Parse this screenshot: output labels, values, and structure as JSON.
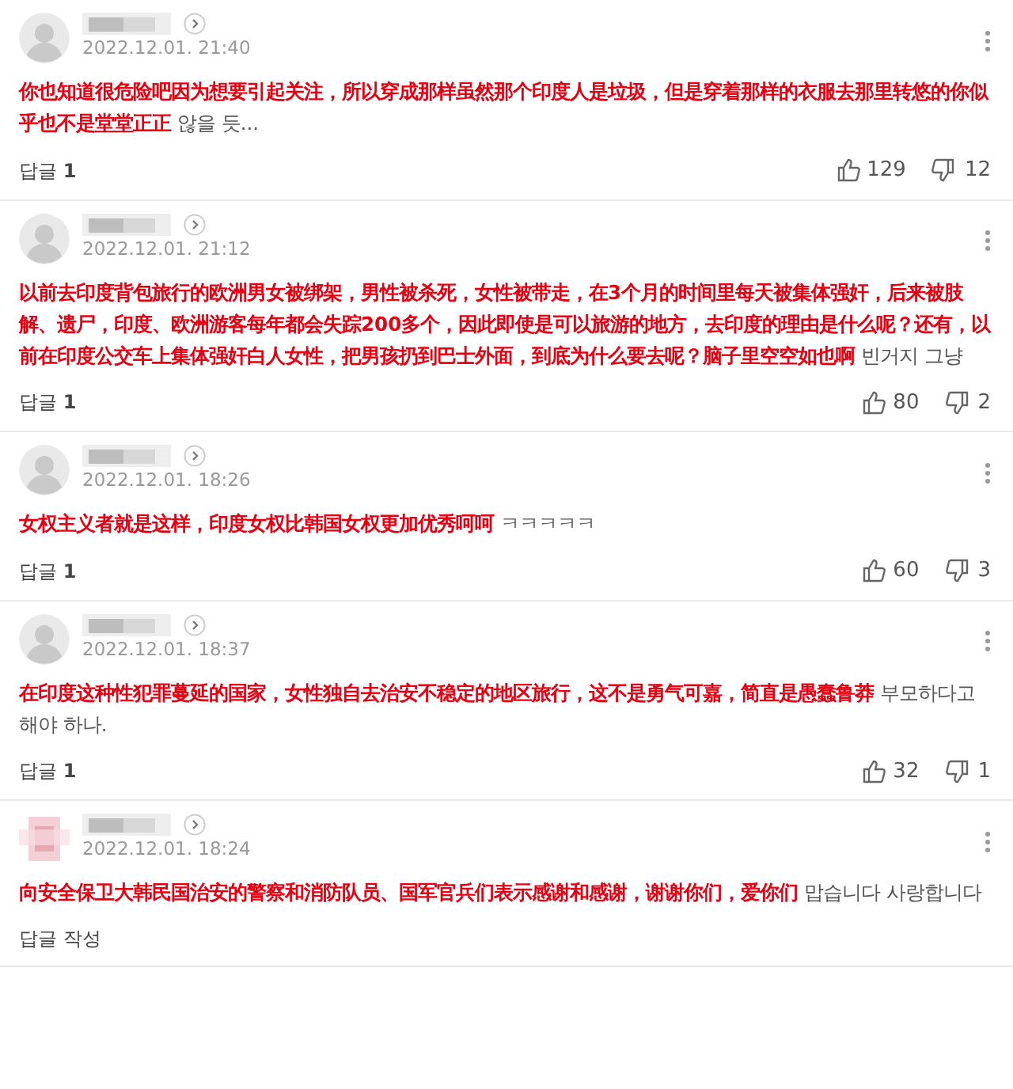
{
  "comments": [
    {
      "blurred_avatar": false,
      "date": "2022.12.01. 21:40",
      "body": "**你也知道很危险吧因为想要引起关注，所以穿成那样虽然那个印度人是垃圾，但是穿着那样的衣服去那里转悠的你似乎也不是堂堂正正** 않을 듯...",
      "reply_label": "답글",
      "reply_count": "1",
      "likes": "129",
      "dislikes": "12"
    },
    {
      "blurred_avatar": false,
      "date": "2022.12.01. 21:12",
      "body": "**以前去印度背包旅行的欧洲男女被绑架，男性被杀死，女性被带走，在3个月的时间里每天被集体强奸，后来被肢解、遗尸，印度、欧洲游客每年都会失踪200多个，因此即使是可以旅游的地方，去印度的理由是什么呢？还有，以前在印度公交车上集体强奸白人女性，把男孩扔到巴士外面，到底为什么要去呢？脑子里空空如也啊** 빈거지 그냥",
      "reply_label": "답글",
      "reply_count": "1",
      "likes": "80",
      "dislikes": "2"
    },
    {
      "blurred_avatar": false,
      "date": "2022.12.01. 18:26",
      "body": "**女权主义者就是这样，印度女权比韩国女权更加优秀呵呵** ㅋㅋㅋㅋㅋ",
      "reply_label": "답글",
      "reply_count": "1",
      "likes": "60",
      "dislikes": "3"
    },
    {
      "blurred_avatar": false,
      "date": "2022.12.01. 18:37",
      "body": "**在印度这种性犯罪蔓延的国家，女性独自去治安不稳定的地区旅行，这不是勇气可嘉，简直是愚蠢鲁莽** 부모하다고 해야 하나.",
      "reply_label": "답글",
      "reply_count": "1",
      "likes": "32",
      "dislikes": "1"
    },
    {
      "blurred_avatar": true,
      "date": "2022.12.01. 18:24",
      "body": "**向安全保卫大韩民国治安的警察和消防队员、国军官兵们表示感谢和感谢，谢谢你们，爱你们** 맙습니다 사랑합니다",
      "reply_label": "답글 작성"
    }
  ]
}
